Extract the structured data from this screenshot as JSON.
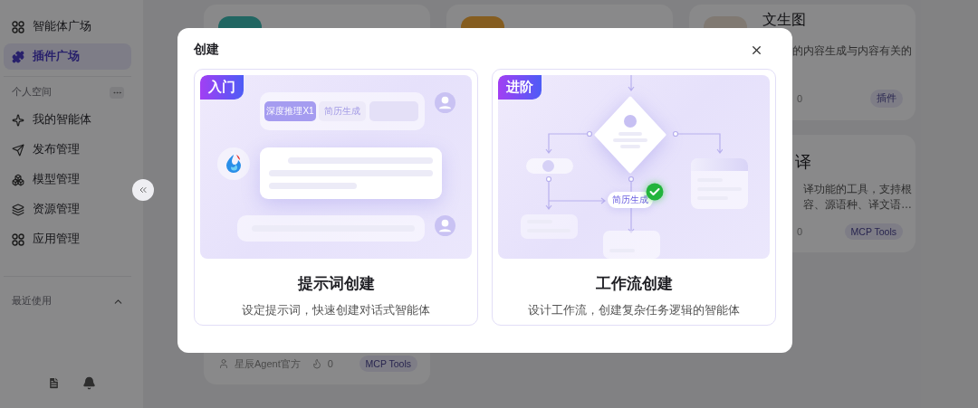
{
  "sidebar": {
    "top_items": [
      {
        "kind": "grid",
        "label": "智能体广场",
        "selected": false
      },
      {
        "kind": "plugin",
        "label": "插件广场",
        "selected": true
      }
    ],
    "personal_section": {
      "title": "个人空间",
      "items": [
        {
          "kind": "agent",
          "label": "我的智能体",
          "selected": false
        },
        {
          "kind": "publish",
          "label": "发布管理",
          "selected": false
        },
        {
          "kind": "model",
          "label": "模型管理",
          "selected": false
        },
        {
          "kind": "resource",
          "label": "资源管理",
          "selected": false
        },
        {
          "kind": "grid",
          "label": "应用管理",
          "selected": false
        }
      ]
    },
    "recent_section": {
      "title": "最近使用",
      "expanded": true
    }
  },
  "plugin_cards": [
    {
      "kind": "icon_only"
    },
    {
      "kind": "icon_only"
    },
    {
      "kind": "full",
      "title": "文生图",
      "description_lines": [
        "的内容生成与内容有关的"
      ],
      "count": "0",
      "tag": "插件"
    },
    {
      "kind": "text",
      "title": "译",
      "description_lines": [
        "译功能的工具，支持根",
        "容、源语种、译文语…"
      ],
      "count": "0",
      "tag": "MCP Tools"
    },
    {
      "kind": "footer",
      "author": "星辰Agent官方",
      "count": "0",
      "tag": "MCP Tools"
    }
  ],
  "dialog": {
    "title": "创建",
    "options": [
      {
        "kind": "prompt",
        "badge": "入门",
        "title": "提示词创建",
        "description": "设定提示词，快速创建对话式智能体",
        "chips": [
          {
            "label": "深度推理X1",
            "selected": true
          },
          {
            "label": "简历生成",
            "selected": false
          }
        ]
      },
      {
        "kind": "workflow",
        "badge": "进阶",
        "title": "工作流创建",
        "description": "设计工作流，创建复杂任务逻辑的智能体",
        "node_label": "简历生成"
      }
    ]
  }
}
